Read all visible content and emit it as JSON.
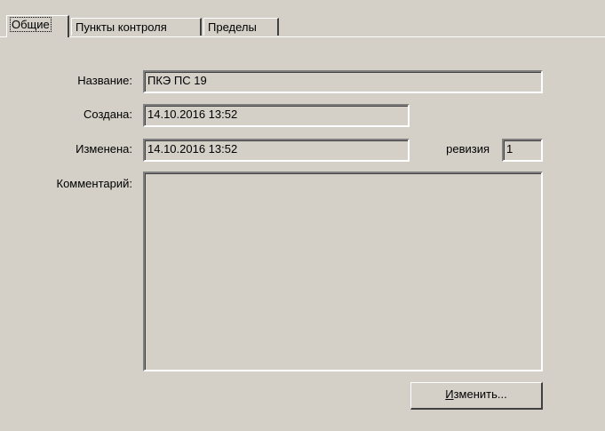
{
  "tabs": [
    {
      "label": "Общие",
      "active": true
    },
    {
      "label": "Пункты контроля",
      "active": false
    },
    {
      "label": "Пределы",
      "active": false
    }
  ],
  "form": {
    "name_label": "Название:",
    "name_value": "ПКЭ ПС 19",
    "created_label": "Создана:",
    "created_value": "14.10.2016 13:52",
    "modified_label": "Изменена:",
    "modified_value": "14.10.2016 13:52",
    "revision_label": "ревизия",
    "revision_value": "1",
    "comment_label": "Комментарий:",
    "comment_value": ""
  },
  "buttons": {
    "edit_mnemonic": "И",
    "edit_rest": "зменить..."
  }
}
